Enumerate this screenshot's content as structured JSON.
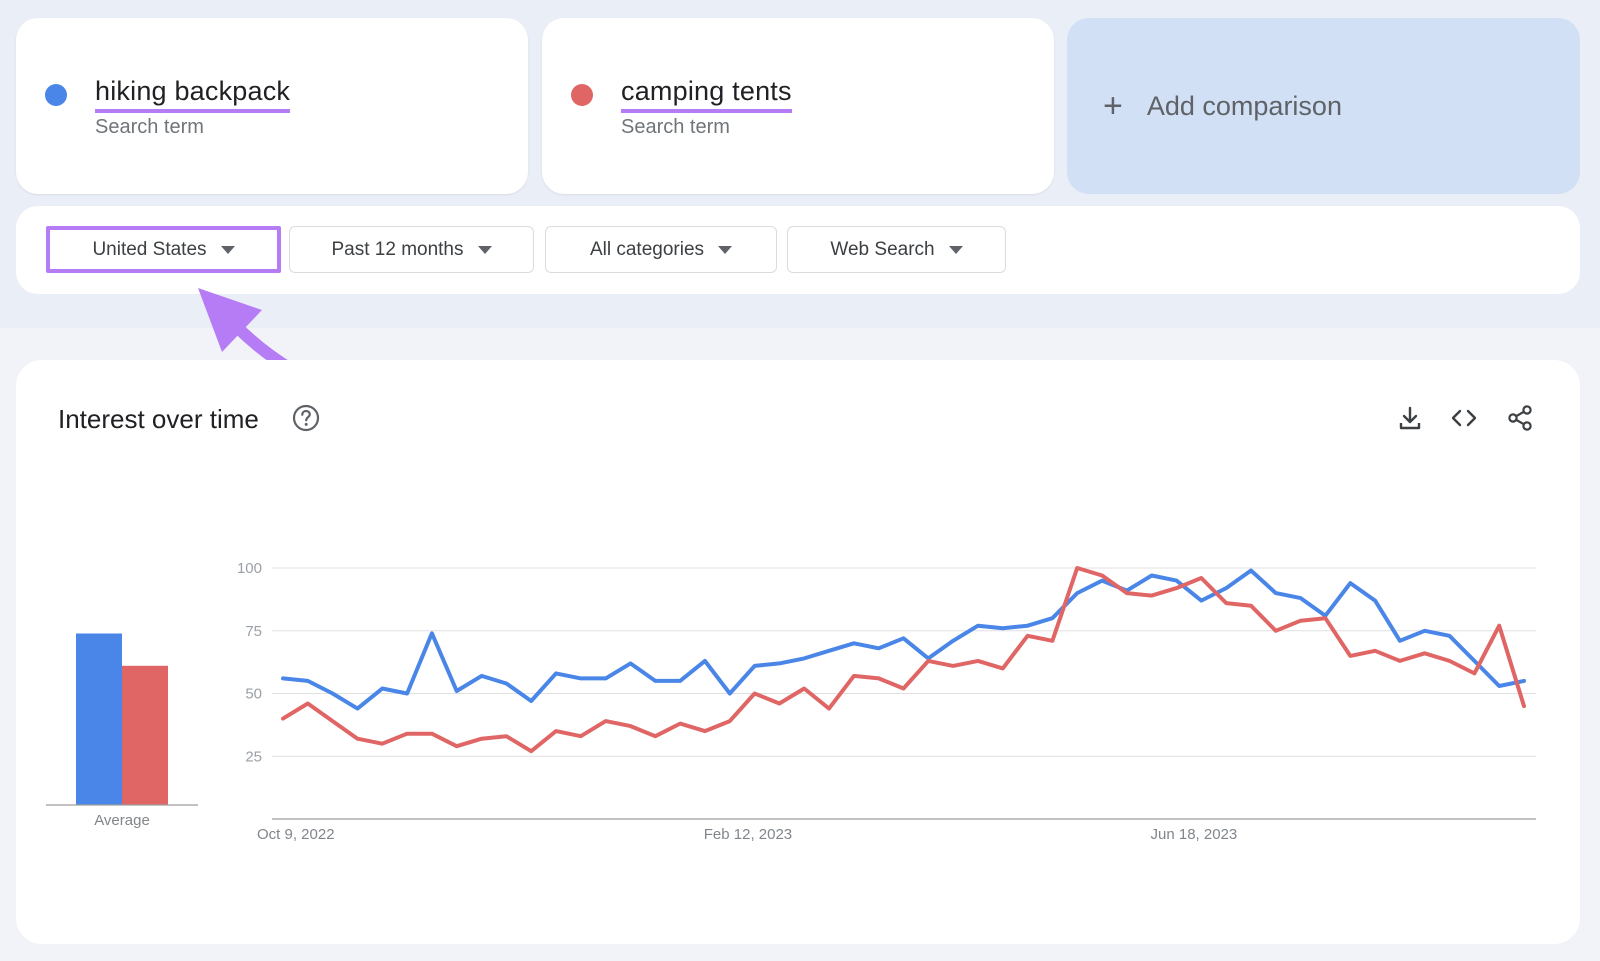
{
  "terms": [
    {
      "label": "hiking backpack",
      "sublabel": "Search term",
      "color": "#4a86e8"
    },
    {
      "label": "camping tents",
      "sublabel": "Search term",
      "color": "#e06666"
    }
  ],
  "add_comparison": {
    "icon": "plus-icon",
    "label": "Add comparison"
  },
  "filters": {
    "region": "United States",
    "time": "Past 12 months",
    "category": "All categories",
    "search_type": "Web Search"
  },
  "chart_card": {
    "title": "Interest over time",
    "icons": [
      "help-icon",
      "download-icon",
      "embed-icon",
      "share-icon"
    ]
  },
  "chart_data": {
    "type": "line",
    "title": "",
    "ylim": [
      0,
      100
    ],
    "yticks": [
      25,
      50,
      75,
      100
    ],
    "x_tick_labels": [
      "Oct 9, 2022",
      "Feb 12, 2023",
      "Jun 18, 2023"
    ],
    "x_tick_indices": [
      0,
      18,
      36
    ],
    "grid": true,
    "series": [
      {
        "name": "hiking backpack",
        "color": "#4a86e8",
        "average": 69,
        "values": [
          56,
          55,
          50,
          44,
          52,
          50,
          74,
          51,
          57,
          54,
          47,
          58,
          56,
          56,
          62,
          55,
          55,
          63,
          50,
          61,
          62,
          64,
          67,
          70,
          68,
          72,
          64,
          71,
          77,
          76,
          77,
          80,
          90,
          95,
          91,
          97,
          95,
          87,
          92,
          99,
          90,
          88,
          81,
          94,
          87,
          71,
          75,
          73,
          63,
          53,
          55
        ]
      },
      {
        "name": "camping tents",
        "color": "#e06666",
        "average": 56,
        "values": [
          40,
          46,
          39,
          32,
          30,
          34,
          34,
          29,
          32,
          33,
          27,
          35,
          33,
          39,
          37,
          33,
          38,
          35,
          39,
          50,
          46,
          52,
          44,
          57,
          56,
          52,
          63,
          61,
          63,
          60,
          73,
          71,
          100,
          97,
          90,
          89,
          92,
          96,
          86,
          85,
          75,
          79,
          80,
          65,
          67,
          63,
          66,
          63,
          58,
          77,
          45
        ]
      }
    ],
    "bar_label": "Average"
  }
}
